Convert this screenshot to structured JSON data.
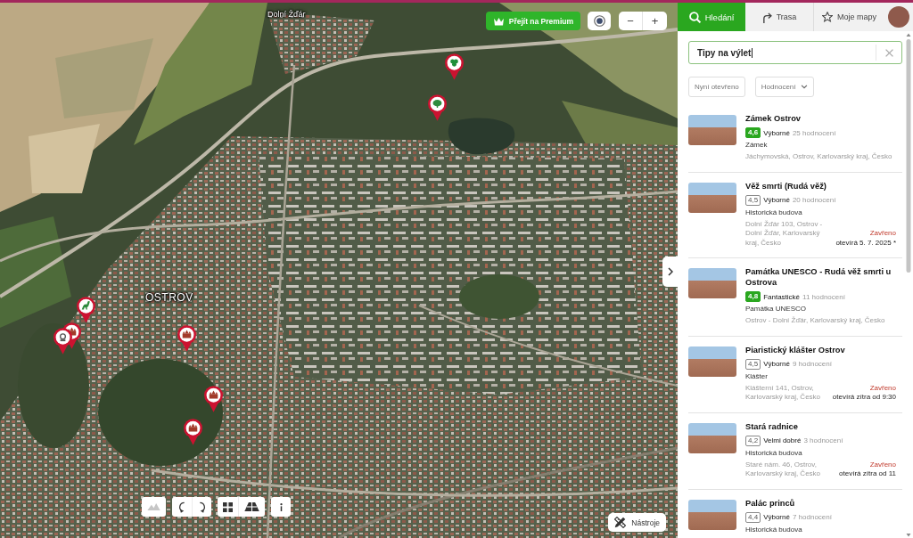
{
  "map": {
    "labels": [
      {
        "text": "Dolní Žďár",
        "kind": "village"
      },
      {
        "text": "OSTROV",
        "kind": "town"
      }
    ],
    "pins": [
      {
        "kind": "leaf"
      },
      {
        "kind": "tree"
      },
      {
        "kind": "dinosaur"
      },
      {
        "kind": "castle"
      },
      {
        "kind": "monument"
      },
      {
        "kind": "castle"
      },
      {
        "kind": "castle"
      },
      {
        "kind": "castle"
      }
    ],
    "premium_button": {
      "label": "Přejít na Premium"
    },
    "zoom_buttons": [
      "−",
      "+"
    ],
    "toolbar": [
      [
        {
          "kind": "terrain",
          "disabled": true
        }
      ],
      [
        {
          "kind": "rotate-left",
          "disabled": false
        },
        {
          "kind": "rotate-right",
          "disabled": false
        }
      ],
      [
        {
          "kind": "grid",
          "disabled": false
        },
        {
          "kind": "perspective",
          "disabled": false
        }
      ],
      [
        {
          "kind": "info",
          "disabled": false
        }
      ]
    ],
    "tools_button": {
      "label": "Nástroje"
    }
  },
  "sidebar": {
    "tabs": [
      {
        "label": "Hledání",
        "kind": "search",
        "selected": true
      },
      {
        "label": "Trasa",
        "kind": "route",
        "selected": false
      },
      {
        "label": "Moje mapy",
        "kind": "star",
        "selected": false
      }
    ],
    "search": {
      "value": "Tipy na výlet"
    },
    "filters": [
      {
        "label": "Nyní otevřeno",
        "kind": "toggle"
      },
      {
        "label": "Hodnocení",
        "kind": "dropdown"
      }
    ],
    "results": [
      {
        "title": "Zámek Ostrov",
        "rating": {
          "score": "4,6",
          "highlighted": true,
          "verdict": "Výborné",
          "count": "25 hodnocení"
        },
        "category": "Zámek",
        "address": "Jáchymovská, Ostrov, Karlovarský kraj, Česko"
      },
      {
        "title": "Věž smrti (Rudá věž)",
        "rating": {
          "score": "4,5",
          "highlighted": false,
          "verdict": "Výborné",
          "count": "20 hodnocení"
        },
        "category": "Historická budova",
        "address": "Dolní Žďár 103, Ostrov - Dolní Žďár, Karlovarský kraj, Česko",
        "status": "Zavřeno",
        "opening": "otevírá 5. 7. 2025 *"
      },
      {
        "title": "Památka UNESCO - Rudá věž smrti u Ostrova",
        "rating": {
          "score": "4,8",
          "highlighted": true,
          "verdict": "Fantastické",
          "count": "11 hodnocení"
        },
        "category": "Památka UNESCO",
        "address": "Ostrov - Dolní Žďár, Karlovarský kraj, Česko"
      },
      {
        "title": "Piaristický klášter Ostrov",
        "rating": {
          "score": "4,5",
          "highlighted": false,
          "verdict": "Výborné",
          "count": "9 hodnocení"
        },
        "category": "Klášter",
        "address": "Klášterní 141, Ostrov, Karlovarský kraj, Česko",
        "status": "Zavřeno",
        "opening": "otevírá zítra od 9:30"
      },
      {
        "title": "Stará radnice",
        "rating": {
          "score": "4,2",
          "highlighted": false,
          "verdict": "Velmi dobré",
          "count": "3 hodnocení"
        },
        "category": "Historická budova",
        "address": "Staré nám. 46, Ostrov, Karlovarský kraj, Česko",
        "status": "Zavřeno",
        "opening": "otevírá zítra od 11"
      },
      {
        "title": "Palác princů",
        "rating": {
          "score": "4,4",
          "highlighted": false,
          "verdict": "Výborné",
          "count": "7 hodnocení"
        },
        "category": "Historická budova"
      }
    ]
  }
}
